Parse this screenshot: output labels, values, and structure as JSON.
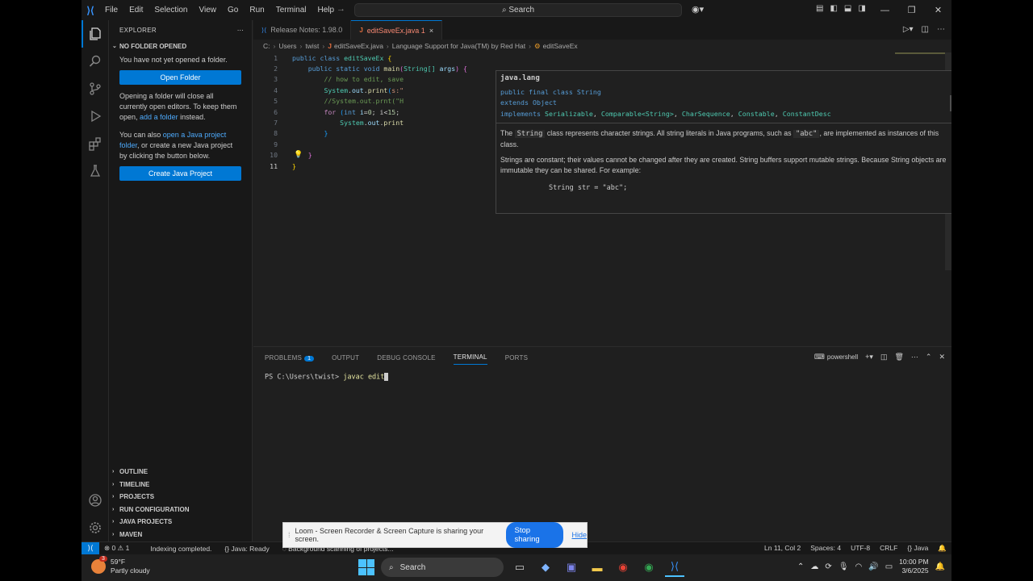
{
  "titlebar": {
    "menu": [
      "File",
      "Edit",
      "Selection",
      "View",
      "Go",
      "Run",
      "Terminal",
      "Help"
    ],
    "search_placeholder": "Search"
  },
  "sidebar": {
    "title": "EXPLORER",
    "section": "NO FOLDER OPENED",
    "text1": "You have not yet opened a folder.",
    "open_folder": "Open Folder",
    "text2_a": "Opening a folder will close all currently open editors. To keep them open,",
    "text2_link": "add a folder",
    "text2_b": "instead.",
    "text3_a": "You can also",
    "text3_link": "open a Java project folder",
    "text3_b": ", or create a new Java project by clicking the button below.",
    "create_java": "Create Java Project",
    "bottom_sections": [
      "OUTLINE",
      "TIMELINE",
      "PROJECTS",
      "RUN CONFIGURATION",
      "JAVA PROJECTS",
      "MAVEN"
    ]
  },
  "tabs": [
    {
      "label": "Release Notes: 1.98.0"
    },
    {
      "label": "editSaveEx.java 1",
      "close": "×"
    }
  ],
  "breadcrumb": [
    "C:",
    "Users",
    "twist",
    "editSaveEx.java",
    "Language Support for Java(TM) by Red Hat",
    "editSaveEx"
  ],
  "code": {
    "l1": {
      "n": "1",
      "a": "public",
      "b": "class",
      "c": "editSaveEx",
      "d": "{"
    },
    "l2": {
      "n": "2",
      "a": "public",
      "b": "static",
      "c": "void",
      "d": "main",
      "e": "(",
      "f": "String[]",
      "g": "args",
      "h": ")",
      "i": "{"
    },
    "l3": {
      "n": "3",
      "a": "// how to edit, save"
    },
    "l4": {
      "n": "4",
      "a": "System",
      "b": ".",
      "c": "out",
      "d": ".",
      "e": "print",
      "f": "(",
      "g": "s:\""
    },
    "l5": {
      "n": "5",
      "a": "//System.out.prnt(\"H"
    },
    "l6": {
      "n": "6",
      "a": "for",
      "b": "(",
      "c": "int",
      "d": "i",
      "e": "=",
      "f": "0",
      "g": "; i<",
      "h": "15",
      "i": ";"
    },
    "l7": {
      "n": "7",
      "a": "System",
      "b": ".",
      "c": "out",
      "d": ".",
      "e": "print"
    },
    "l8": {
      "n": "8",
      "a": "}"
    },
    "l9": {
      "n": "9"
    },
    "l10": {
      "n": "10",
      "a": "}"
    },
    "l11": {
      "n": "11",
      "a": "}"
    }
  },
  "hover": {
    "package": "java.lang",
    "sig1": "public final class String",
    "sig2": "extends Object",
    "sig3_a": "implements",
    "sig3_b": "Serializable",
    "sig3_c": "Comparable<String>",
    "sig3_d": "CharSequence",
    "sig3_e": "Constable",
    "sig3_f": "ConstantDesc",
    "doc1_a": "The",
    "doc1_code": "String",
    "doc1_b": "class represents character strings. All string literals in Java programs, such as",
    "doc1_code2": "\"abc\"",
    "doc1_c": ", are implemented as instances of this class.",
    "doc2": "Strings are constant; their values cannot be changed after they are created. String buffers support mutable strings. Because String objects are immutable they can be shared. For example:",
    "example": "String str = \"abc\";"
  },
  "panel": {
    "tabs": [
      "PROBLEMS",
      "OUTPUT",
      "DEBUG CONSOLE",
      "TERMINAL",
      "PORTS"
    ],
    "problems_count": "1",
    "shell": "powershell",
    "prompt": "PS C:\\Users\\twist> ",
    "command": "javac edit"
  },
  "statusbar": {
    "errors": "0",
    "warnings": "1",
    "indexing": "Indexing completed.",
    "java": "Java: Ready",
    "scanning": "Background scanning of projects...",
    "position": "Ln 11, Col 2",
    "spaces": "Spaces: 4",
    "encoding": "UTF-8",
    "eol": "CRLF",
    "lang": "Java"
  },
  "toast": {
    "message": "Loom - Screen Recorder & Screen Capture is sharing your screen.",
    "stop": "Stop sharing",
    "hide": "Hide"
  },
  "taskbar": {
    "badge": "3",
    "temp": "59°F",
    "weather": "Partly cloudy",
    "search": "Search",
    "time": "10:00 PM",
    "date": "3/6/2025"
  },
  "colors": {
    "accent": "#0078d4",
    "background": "#1f1f1f"
  }
}
